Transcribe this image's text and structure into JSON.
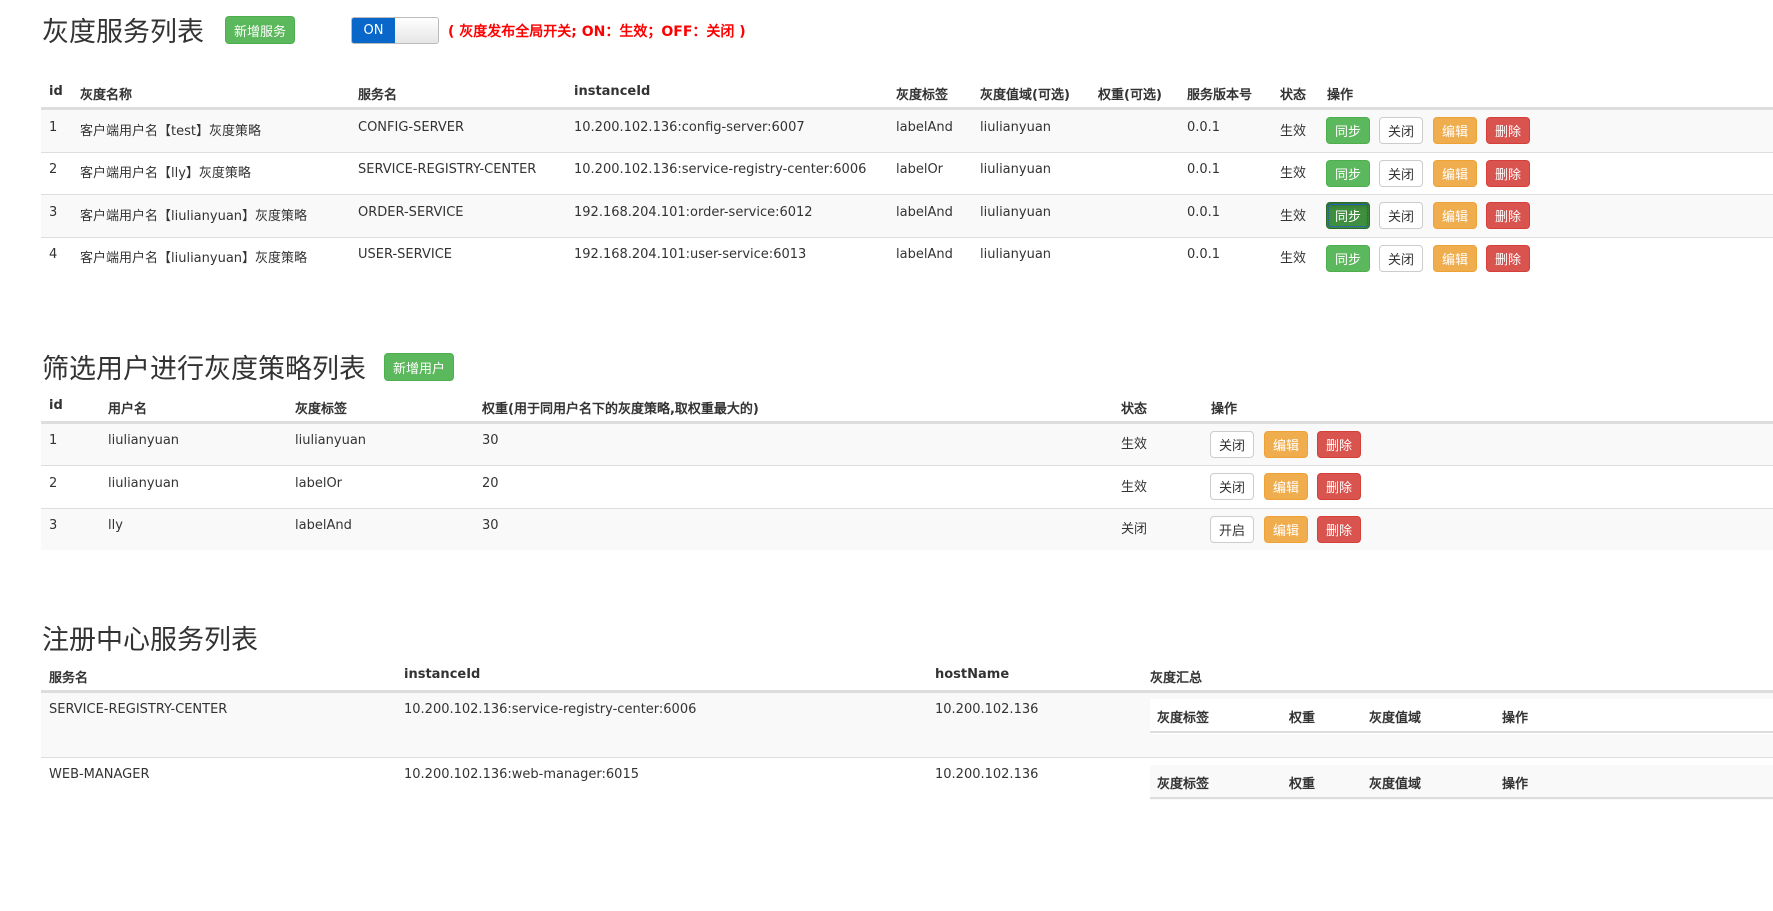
{
  "gray_services": {
    "title": "灰度服务列表",
    "add_label": "新增服务",
    "toggle_label": "ON",
    "global_note": "( 灰度发布全局开关; ON：生效；OFF：关闭 )",
    "headers": [
      "id",
      "灰度名称",
      "服务名",
      "instanceId",
      "灰度标签",
      "灰度值域(可选)",
      "权重(可选)",
      "服务版本号",
      "状态",
      "操作"
    ],
    "rows": [
      {
        "id": "1",
        "name": "客户端用户名【test】灰度策略",
        "service": "CONFIG-SERVER",
        "instance": "10.200.102.136:config-server:6007",
        "tag": "labelAnd",
        "range": "liulianyuan",
        "weight": "",
        "version": "0.0.1",
        "status": "生效"
      },
      {
        "id": "2",
        "name": "客户端用户名【lly】灰度策略",
        "service": "SERVICE-REGISTRY-CENTER",
        "instance": "10.200.102.136:service-registry-center:6006",
        "tag": "labelOr",
        "range": "liulianyuan",
        "weight": "",
        "version": "0.0.1",
        "status": "生效"
      },
      {
        "id": "3",
        "name": "客户端用户名【liulianyuan】灰度策略",
        "service": "ORDER-SERVICE",
        "instance": "192.168.204.101:order-service:6012",
        "tag": "labelAnd",
        "range": "liulianyuan",
        "weight": "",
        "version": "0.0.1",
        "status": "生效"
      },
      {
        "id": "4",
        "name": "客户端用户名【liulianyuan】灰度策略",
        "service": "USER-SERVICE",
        "instance": "192.168.204.101:user-service:6013",
        "tag": "labelAnd",
        "range": "liulianyuan",
        "weight": "",
        "version": "0.0.1",
        "status": "生效"
      }
    ],
    "actions": {
      "sync": "同步",
      "close": "关闭",
      "edit": "编辑",
      "delete": "删除"
    }
  },
  "user_strategies": {
    "title": "筛选用户进行灰度策略列表",
    "add_label": "新增用户",
    "headers": [
      "id",
      "用户名",
      "灰度标签",
      "权重(用于同用户名下的灰度策略,取权重最大的)",
      "状态",
      "操作"
    ],
    "rows": [
      {
        "id": "1",
        "user": "liulianyuan",
        "tag": "liulianyuan",
        "weight": "30",
        "status": "生效",
        "toggle": "关闭"
      },
      {
        "id": "2",
        "user": "liulianyuan",
        "tag": "labelOr",
        "weight": "20",
        "status": "生效",
        "toggle": "关闭"
      },
      {
        "id": "3",
        "user": "lly",
        "tag": "labelAnd",
        "weight": "30",
        "status": "关闭",
        "toggle": "开启"
      }
    ],
    "actions": {
      "edit": "编辑",
      "delete": "删除"
    }
  },
  "registry": {
    "title": "注册中心服务列表",
    "headers": [
      "服务名",
      "instanceId",
      "hostName",
      "灰度汇总"
    ],
    "sub_headers": [
      "灰度标签",
      "权重",
      "灰度值域",
      "操作"
    ],
    "rows": [
      {
        "service": "SERVICE-REGISTRY-CENTER",
        "instance": "10.200.102.136:service-registry-center:6006",
        "host": "10.200.102.136"
      },
      {
        "service": "WEB-MANAGER",
        "instance": "10.200.102.136:web-manager:6015",
        "host": "10.200.102.136"
      }
    ]
  },
  "colors": {
    "success": "#5cb85c",
    "warning": "#f0ad4e",
    "danger": "#d9534f",
    "toggle_on": "#0867c9",
    "note": "#ff0000"
  }
}
